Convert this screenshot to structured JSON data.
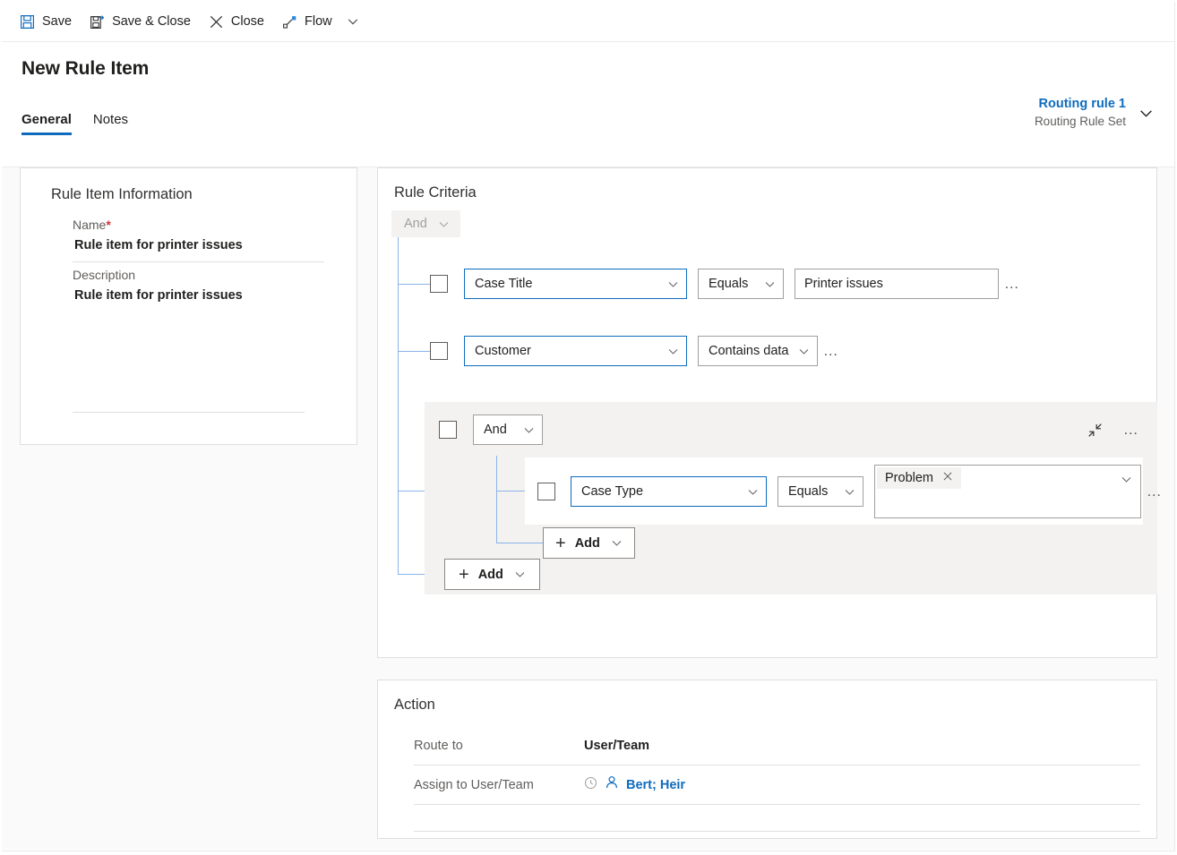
{
  "commandbar": {
    "items": [
      {
        "label": "Save",
        "icon": "save-icon"
      },
      {
        "label": "Save & Close",
        "icon": "save-and-close-icon"
      },
      {
        "label": "Close",
        "icon": "close-x-icon"
      },
      {
        "label": "Flow",
        "icon": "flow-icon"
      }
    ],
    "overflow_icon": "chevron-down-icon"
  },
  "header": {
    "title": "New Rule Item",
    "tabs": [
      {
        "label": "General",
        "active": true
      },
      {
        "label": "Notes",
        "active": false
      }
    ],
    "record_link": "Routing rule 1",
    "record_subtitle": "Routing Rule Set",
    "expand_icon": "chevron-down-icon"
  },
  "rule_item_information": {
    "section_title": "Rule Item Information",
    "name_label": "Name",
    "name_required_mark": "*",
    "name_value": "Rule item for printer issues",
    "description_label": "Description",
    "description_value": "Rule item for printer issues"
  },
  "rule_criteria": {
    "section_title": "Rule Criteria",
    "root_logic": "And",
    "root_logic_disabled": true,
    "rows": [
      {
        "attribute": "Case Title",
        "operator": "Equals",
        "value": "Printer issues",
        "has_value": true,
        "more_icon": "ellipsis-icon"
      },
      {
        "attribute": "Customer",
        "operator": "Contains data",
        "value": "",
        "has_value": false,
        "more_icon": "ellipsis-icon"
      }
    ],
    "group": {
      "logic": "And",
      "collapse_icon": "collapse-icon",
      "more_icon": "ellipsis-icon",
      "rows": [
        {
          "attribute": "Case Type",
          "operator": "Equals",
          "value_tag": "Problem",
          "tag_remove_icon": "close-x-icon",
          "more_icon": "ellipsis-icon"
        }
      ],
      "add_label": "Add",
      "add_icon": "plus-icon"
    },
    "add_label": "Add",
    "add_icon": "plus-icon"
  },
  "action": {
    "section_title": "Action",
    "route_to_label": "Route to",
    "route_to_value": "User/Team",
    "assign_label": "Assign to User/Team",
    "assign_value": "Bert; Heir",
    "assign_recent_icon": "recent-clock-icon",
    "assign_person_icon": "person-icon"
  },
  "colors": {
    "accent": "#0f6cbd",
    "link": "#0f6cbd",
    "required": "#d13438",
    "tree_line": "#8ab4e8",
    "group_bg": "#f3f2f1",
    "page_bg": "#fafafa"
  }
}
